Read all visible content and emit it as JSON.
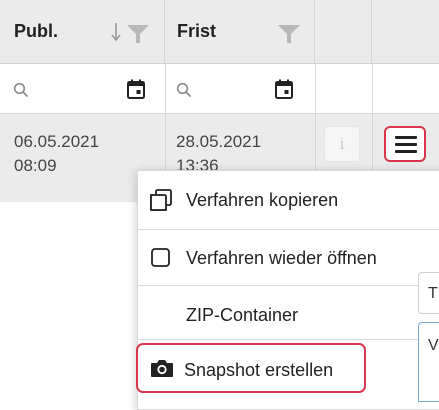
{
  "table": {
    "columns": [
      {
        "label": "Publ."
      },
      {
        "label": "Frist"
      }
    ],
    "row": {
      "publ_date": "06.05.2021",
      "publ_time": "08:09",
      "frist_date": "28.05.2021",
      "frist_time": "13:36",
      "info_label": "i"
    }
  },
  "menu": {
    "items": [
      {
        "label": "Verfahren kopieren",
        "icon": "copy-icon"
      },
      {
        "label": "Verfahren wieder öffnen",
        "icon": "checkbox-icon"
      },
      {
        "label": "ZIP-Container",
        "icon": ""
      },
      {
        "label": "Snapshot erstellen",
        "icon": "camera-icon"
      }
    ]
  },
  "behind_panel": {
    "field1_text": "T",
    "field2_text": "V"
  },
  "colors": {
    "highlight": "#d9364b",
    "header_bg": "#ebebeb"
  }
}
